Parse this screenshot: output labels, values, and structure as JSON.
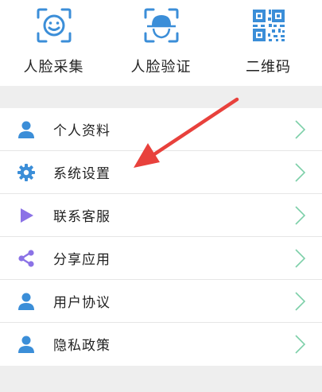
{
  "top_actions": [
    {
      "label": "人脸采集",
      "icon": "face-capture-icon"
    },
    {
      "label": "人脸验证",
      "icon": "face-verify-icon"
    },
    {
      "label": "二维码",
      "icon": "qr-code-icon"
    }
  ],
  "menu": [
    {
      "label": "个人资料",
      "icon": "person-icon"
    },
    {
      "label": "系统设置",
      "icon": "gear-icon"
    },
    {
      "label": "联系客服",
      "icon": "play-icon"
    },
    {
      "label": "分享应用",
      "icon": "share-icon"
    },
    {
      "label": "用户协议",
      "icon": "person-icon"
    },
    {
      "label": "隐私政策",
      "icon": "person-icon"
    }
  ],
  "colors": {
    "icon_blue": "#3b8ed8",
    "icon_purple": "#8b72e6",
    "annotation_red": "#e8413c",
    "chevron": "#7ccfa8"
  }
}
